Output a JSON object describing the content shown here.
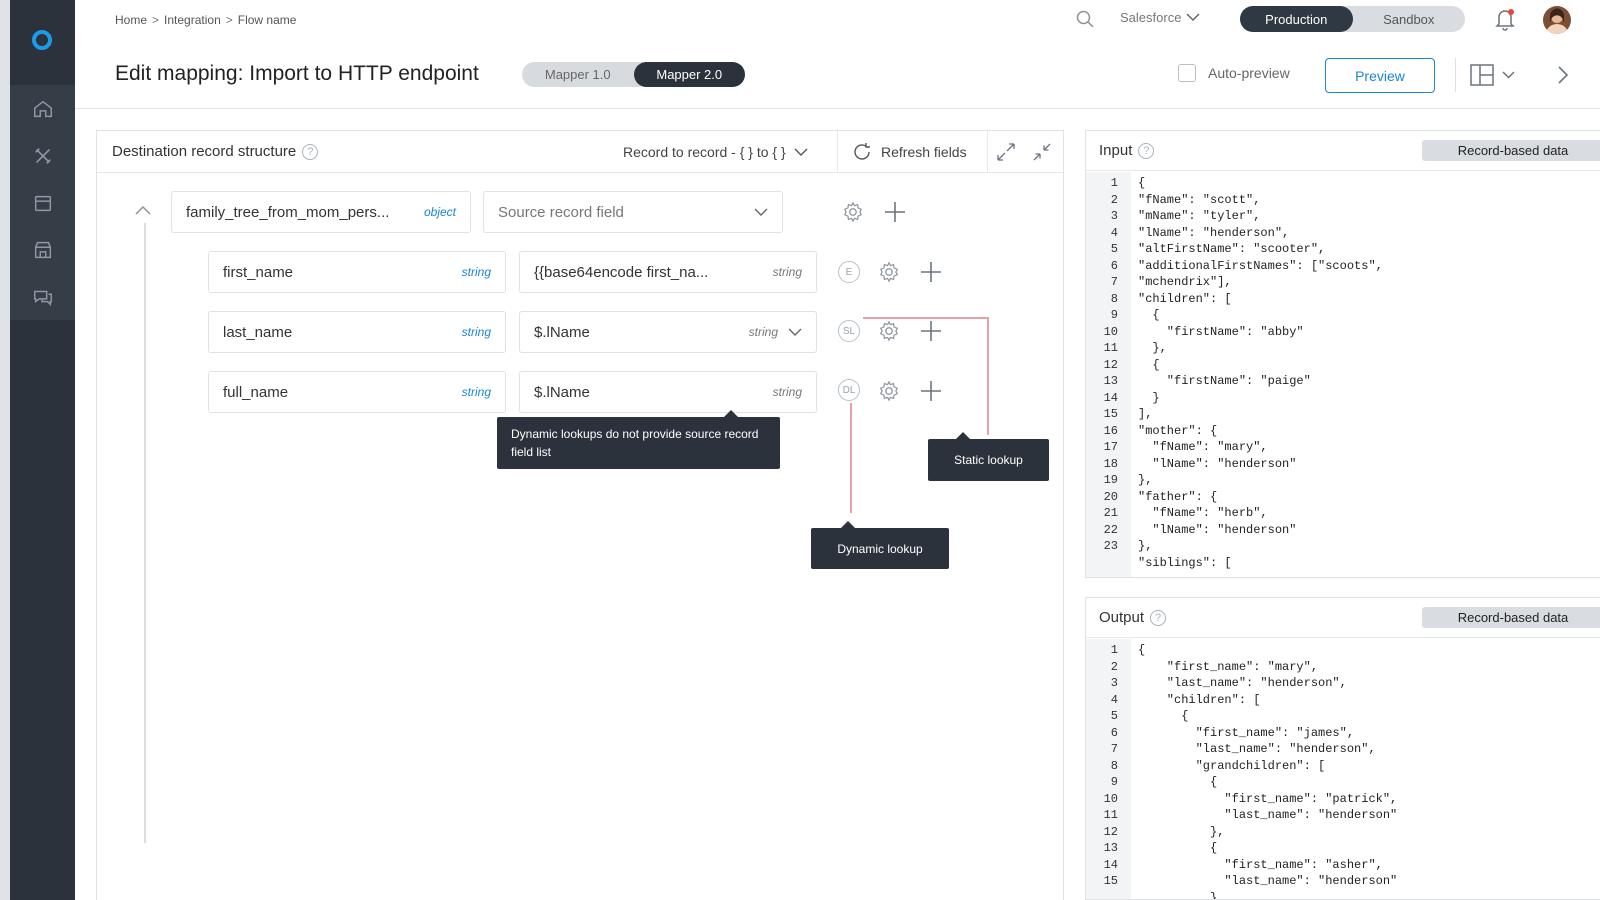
{
  "breadcrumb": [
    "Home",
    "Integration",
    "Flow name"
  ],
  "account": {
    "label": "Salesforce"
  },
  "environment": {
    "active": "Production",
    "inactive": "Sandbox"
  },
  "page": {
    "title": "Edit mapping: Import to HTTP endpoint"
  },
  "mapper": {
    "v1": "Mapper 1.0",
    "v2": "Mapper 2.0",
    "selected": "Mapper 2.0"
  },
  "autopreview": {
    "label": "Auto-preview",
    "checked": false
  },
  "preview_button": "Preview",
  "destination": {
    "title": "Destination record structure",
    "record_select": "Record to record - { } to { }",
    "refresh_label": "Refresh fields",
    "root": {
      "name": "family_tree_from_mom_pers...",
      "type": "object",
      "source_placeholder": "Source record field"
    },
    "rows": [
      {
        "name": "first_name",
        "type": "string",
        "source": "{{base64encode first_na...",
        "source_type": "string",
        "badge": "E"
      },
      {
        "name": "last_name",
        "type": "string",
        "source": "$.lName",
        "source_type": "string",
        "badge": "SL"
      },
      {
        "name": "full_name",
        "type": "string",
        "source": "$.lName",
        "source_type": "string",
        "badge": "DL"
      }
    ]
  },
  "tooltips": {
    "dynamic_no_source": "Dynamic lookups do not provide source record field list",
    "static_lookup": "Static lookup",
    "dynamic_lookup": "Dynamic lookup"
  },
  "input_panel": {
    "title": "Input",
    "chip": "Record-based data",
    "lines": [
      {
        "n": "1",
        "t": "{"
      },
      {
        "n": "2",
        "t": "\"fName\": \"scott\","
      },
      {
        "n": "3",
        "t": "\"mName\": \"tyler\","
      },
      {
        "n": "4",
        "t": "\"lName\": \"henderson\","
      },
      {
        "n": "5",
        "t": "\"altFirstName\": \"scooter\","
      },
      {
        "n": "6",
        "t": "\"additionalFirstNames\": [\"scoots\","
      },
      {
        "n": "7",
        "t": "\"mchendrix\"],"
      },
      {
        "n": "8",
        "t": "\"children\": ["
      },
      {
        "n": "9",
        "t": "  {"
      },
      {
        "n": "10",
        "t": "    \"firstName\": \"abby\""
      },
      {
        "n": "11",
        "t": "  },"
      },
      {
        "n": "12",
        "t": "  {"
      },
      {
        "n": "13",
        "t": "    \"firstName\": \"paige\""
      },
      {
        "n": "14",
        "t": "  }"
      },
      {
        "n": "15",
        "t": "],"
      },
      {
        "n": "16",
        "t": "\"mother\": {"
      },
      {
        "n": "17",
        "t": "  \"fName\": \"mary\","
      },
      {
        "n": "18",
        "t": "  \"lName\": \"henderson\""
      },
      {
        "n": "19",
        "t": "},"
      },
      {
        "n": "20",
        "t": "\"father\": {"
      },
      {
        "n": "21",
        "t": "  \"fName\": \"herb\","
      },
      {
        "n": "22",
        "t": "  \"lName\": \"henderson\""
      },
      {
        "n": "23",
        "t": "},"
      },
      {
        "n": "",
        "t": "\"siblings\": ["
      }
    ]
  },
  "output_panel": {
    "title": "Output",
    "chip": "Record-based data",
    "lines": [
      {
        "n": "1",
        "t": "{"
      },
      {
        "n": "2",
        "t": "    \"first_name\": \"mary\","
      },
      {
        "n": "3",
        "t": "    \"last_name\": \"henderson\","
      },
      {
        "n": "4",
        "t": "    \"children\": ["
      },
      {
        "n": "5",
        "t": "      {"
      },
      {
        "n": "6",
        "t": "        \"first_name\": \"james\","
      },
      {
        "n": "7",
        "t": "        \"last_name\": \"henderson\","
      },
      {
        "n": "8",
        "t": "        \"grandchildren\": ["
      },
      {
        "n": "9",
        "t": "          {"
      },
      {
        "n": "10",
        "t": "            \"first_name\": \"patrick\","
      },
      {
        "n": "11",
        "t": "            \"last_name\": \"henderson\""
      },
      {
        "n": "12",
        "t": "          },"
      },
      {
        "n": "13",
        "t": "          {"
      },
      {
        "n": "14",
        "t": "            \"first_name\": \"asher\","
      },
      {
        "n": "15",
        "t": "            \"last_name\": \"henderson\""
      },
      {
        "n": "",
        "t": "          },"
      }
    ]
  },
  "colors": {
    "accent": "#1b85d6",
    "sidebar": "#2b323b",
    "lookup_line": "#e8a1a6"
  }
}
